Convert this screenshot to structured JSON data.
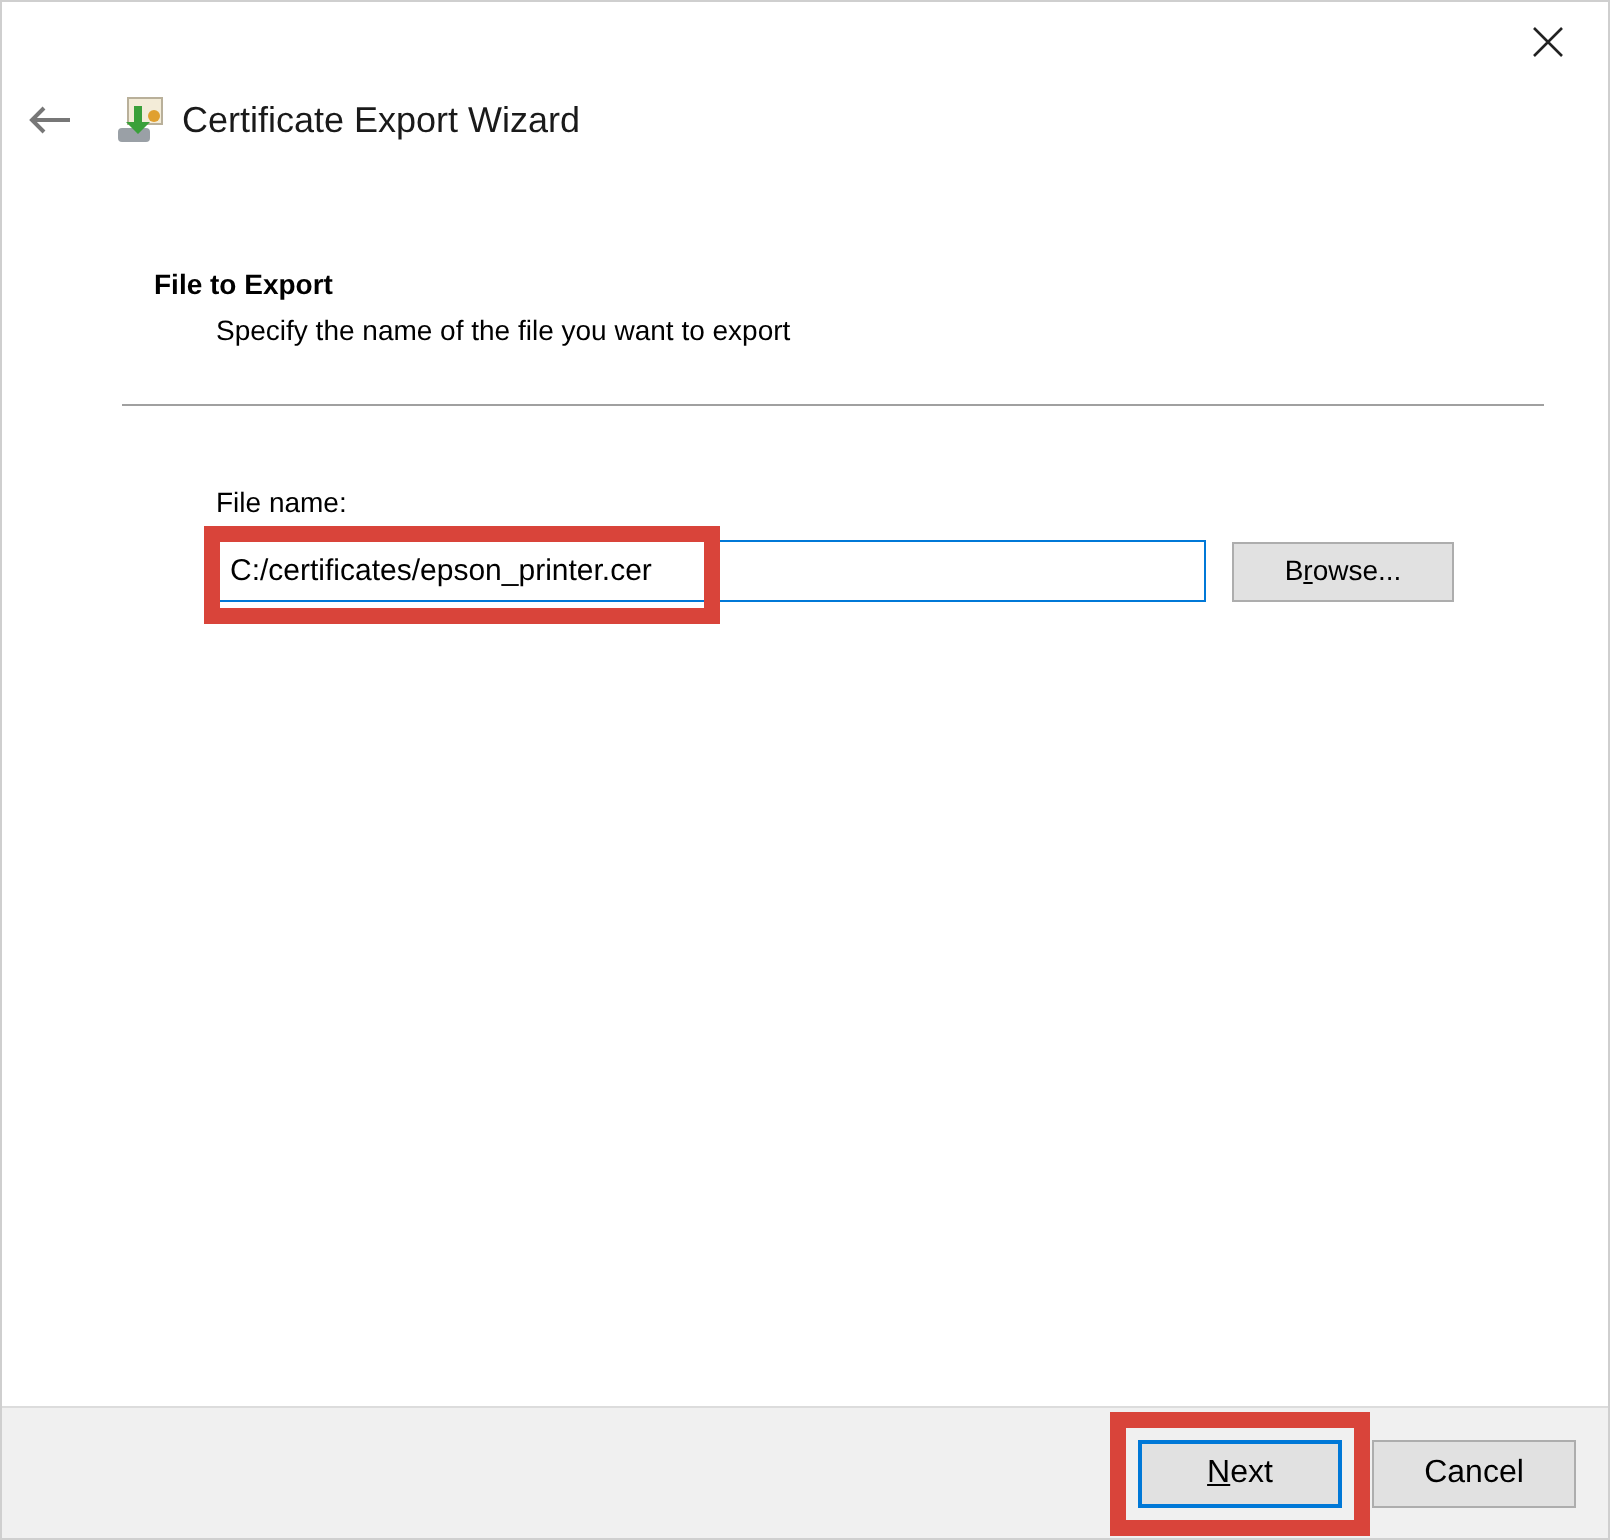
{
  "window": {
    "title": "Certificate Export Wizard"
  },
  "section": {
    "heading": "File to Export",
    "description": "Specify the name of the file you want to export"
  },
  "file_name": {
    "label": "File name:",
    "value": "C:/certificates/epson_printer.cer",
    "highlighted": true
  },
  "browse_button": {
    "label_before": "B",
    "access_key": "r",
    "label_after": "owse..."
  },
  "footer_buttons": [
    {
      "access_key": "N",
      "label_after": "ext",
      "default": true,
      "highlighted": true
    },
    {
      "label_before": "Cancel",
      "default": false,
      "highlighted": false
    }
  ]
}
